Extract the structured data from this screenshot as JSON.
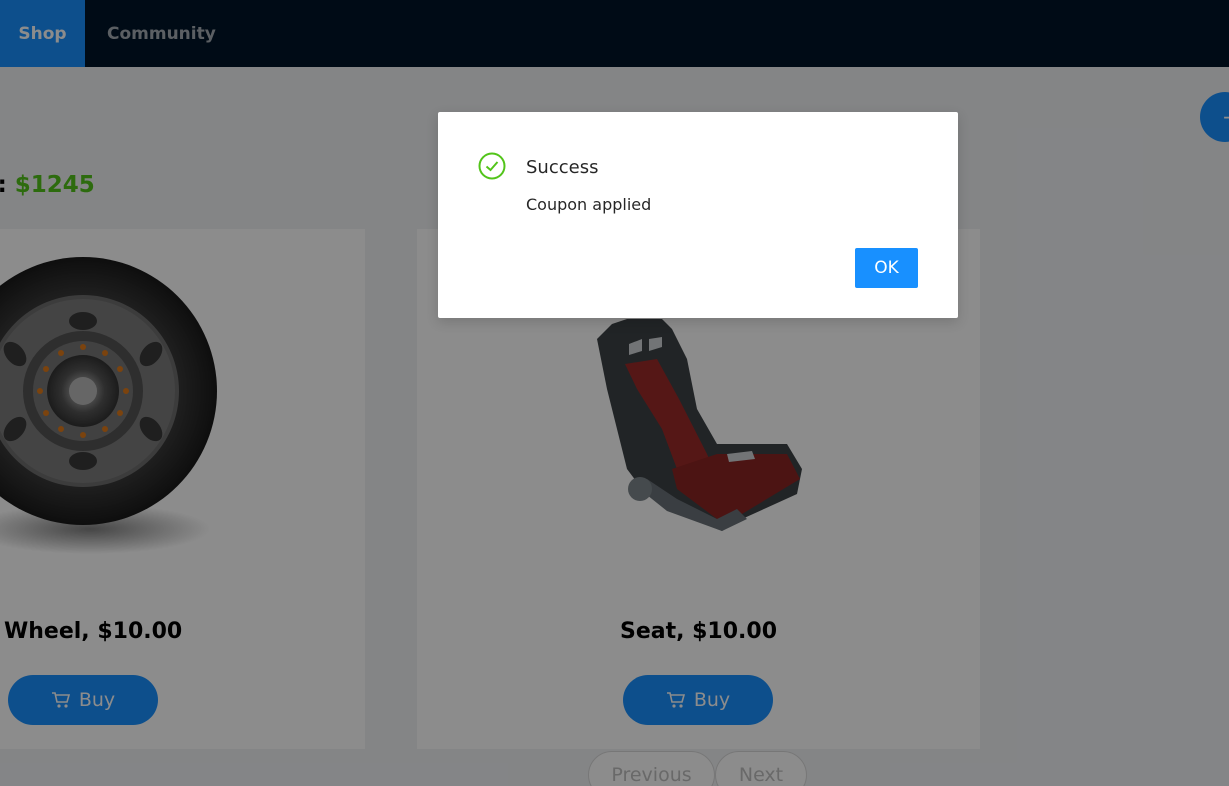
{
  "nav": {
    "items": [
      {
        "label": "Shop",
        "active": true
      },
      {
        "label": "Community",
        "active": false
      }
    ]
  },
  "balance": {
    "label_fragment": "e:",
    "amount": "$1245"
  },
  "products": [
    {
      "title": "Wheel, $10.00",
      "buy_label": "Buy",
      "image": "wheel"
    },
    {
      "title": "Seat, $10.00",
      "buy_label": "Buy",
      "image": "racing-seat"
    }
  ],
  "pagination": {
    "previous_label": "Previous",
    "next_label": "Next"
  },
  "modal": {
    "title": "Success",
    "content": "Coupon applied",
    "ok_label": "OK",
    "icon": "check-circle-icon"
  },
  "colors": {
    "nav_bg": "#001529",
    "primary": "#1890ff",
    "success": "#52c41a"
  }
}
